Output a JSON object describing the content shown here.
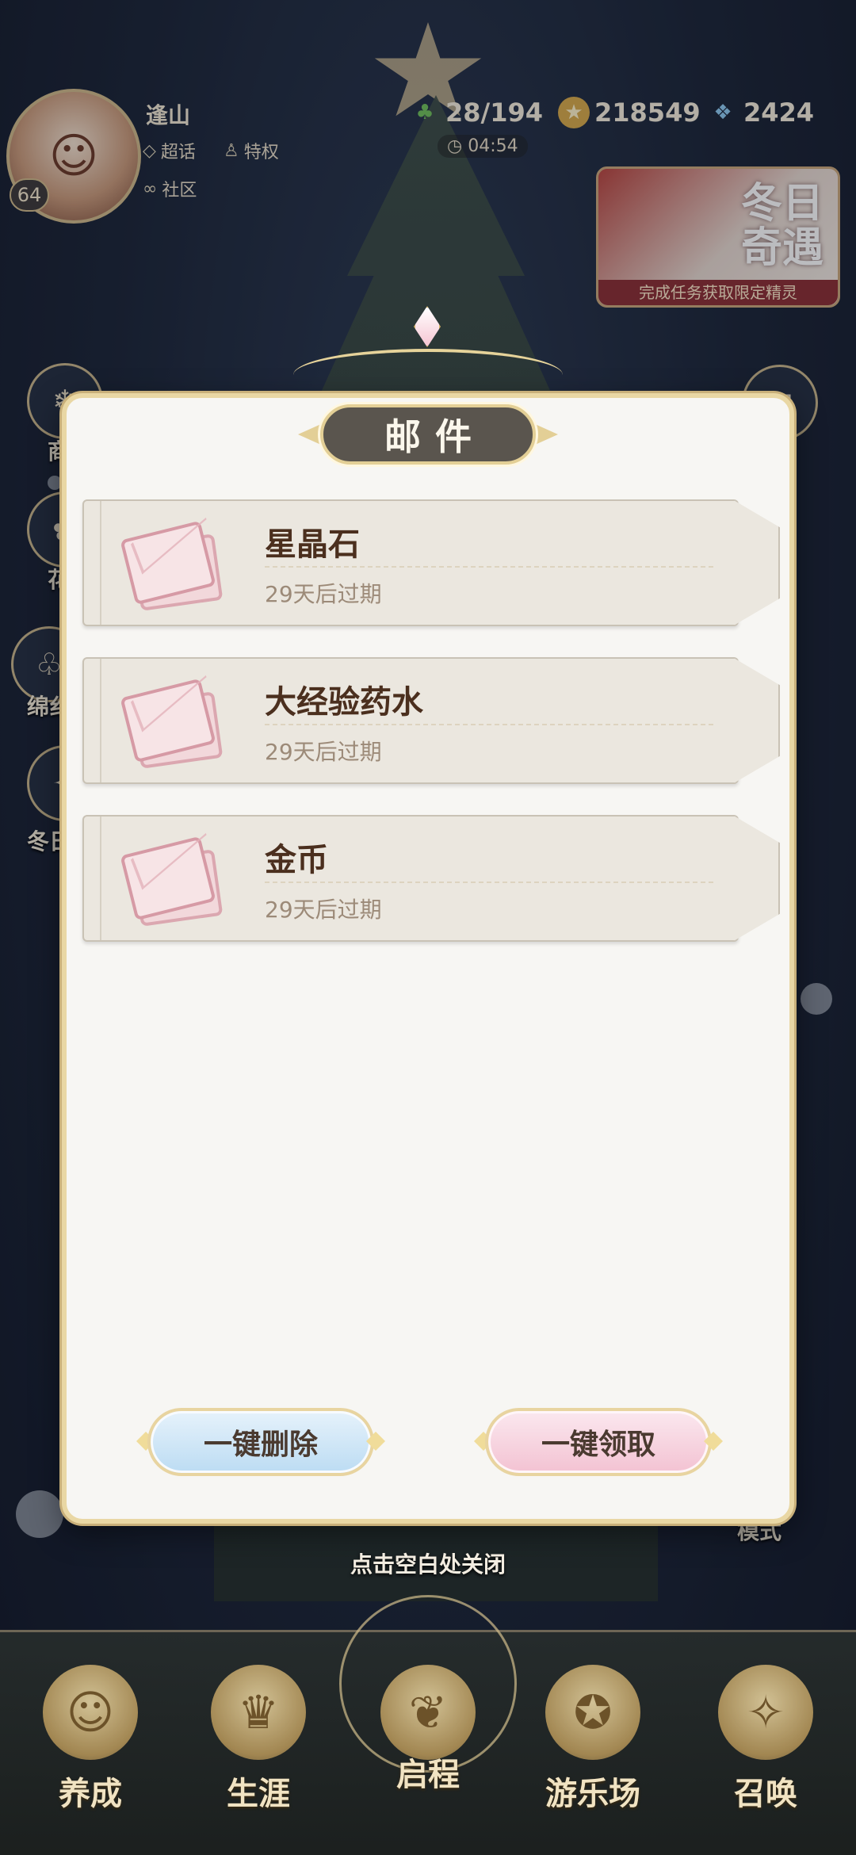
{
  "hud": {
    "player_name": "逢山",
    "level": "64",
    "tag_super_topic": "超话",
    "tag_privilege": "特权",
    "tag_community": "社区",
    "resource_stamina": "28/194",
    "resource_coins": "218549",
    "resource_crystals": "2424",
    "timer": "04:54"
  },
  "event": {
    "title": "冬日奇遇",
    "subtitle": "完成任务获取限定精灵"
  },
  "side_labels": [
    "商",
    "花",
    "绵纟",
    "冬日"
  ],
  "right_label": "模式",
  "modal": {
    "title": "邮件",
    "mails": [
      {
        "title": "星晶石",
        "expire": "29天后过期"
      },
      {
        "title": "大经验药水",
        "expire": "29天后过期"
      },
      {
        "title": "金币",
        "expire": "29天后过期"
      }
    ],
    "delete_all": "一键删除",
    "claim_all": "一键领取"
  },
  "close_hint": "点击空白处关闭",
  "nav": {
    "items": [
      {
        "label": "养成"
      },
      {
        "label": "生涯"
      },
      {
        "label": "启程"
      },
      {
        "label": "游乐场"
      },
      {
        "label": "召唤"
      }
    ]
  },
  "colors": {
    "modal_bg": "#f7f6f3",
    "gold_border": "#e9d7a4",
    "title_plate": "#5a554e",
    "delete_button": "#bcdcf3",
    "claim_button": "#f3c2d2"
  }
}
